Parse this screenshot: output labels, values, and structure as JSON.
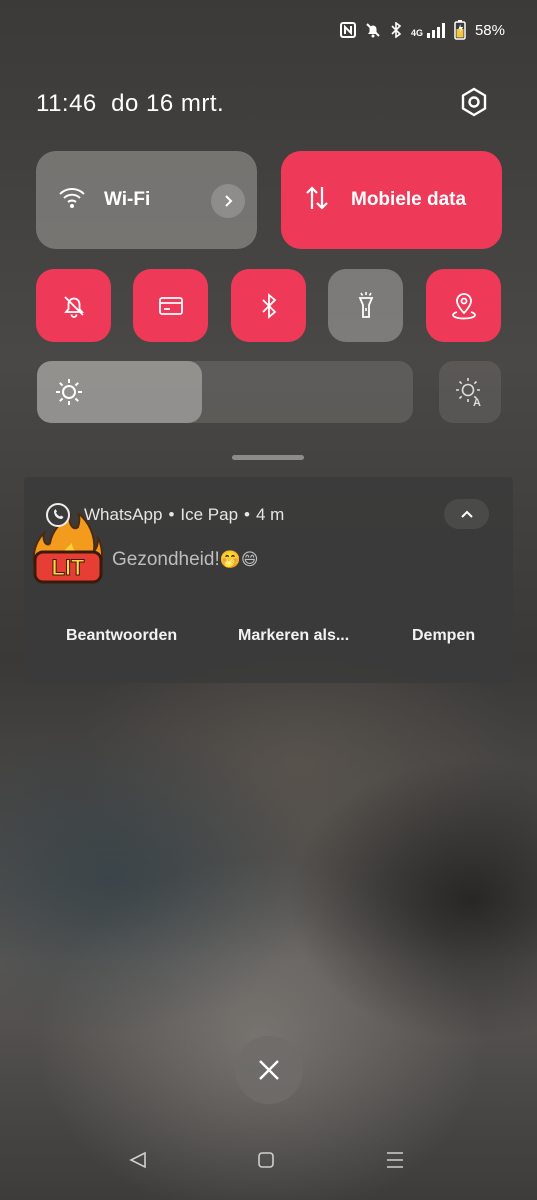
{
  "status_bar": {
    "battery_percent": "58%",
    "network": "4G",
    "icons": [
      "nfc-icon",
      "bell-off-icon",
      "bluetooth-icon",
      "signal-4g-icon",
      "battery-icon"
    ]
  },
  "header": {
    "time": "11:46",
    "date": "do 16 mrt."
  },
  "quick_settings": {
    "wifi_label": "Wi-Fi",
    "mobile_data_label": "Mobiele data",
    "small_tiles": [
      {
        "name": "do-not-disturb",
        "icon": "bell-off-icon",
        "active": true
      },
      {
        "name": "nfc-card",
        "icon": "card-icon",
        "active": true
      },
      {
        "name": "bluetooth",
        "icon": "bluetooth-icon",
        "active": true
      },
      {
        "name": "flashlight",
        "icon": "flashlight-icon",
        "active": false
      },
      {
        "name": "location",
        "icon": "location-icon",
        "active": true
      }
    ],
    "brightness_level": 0.44,
    "accent_color": "#ee3a58"
  },
  "notification": {
    "app": "WhatsApp",
    "sender": "Ice Pap",
    "age": "4 m",
    "separator": "•",
    "message": "Gezondheid!",
    "message_emoji": "🤭😄",
    "avatar_text": "LIT",
    "actions": [
      "Beantwoorden",
      "Markeren als...",
      "Dempen"
    ]
  }
}
